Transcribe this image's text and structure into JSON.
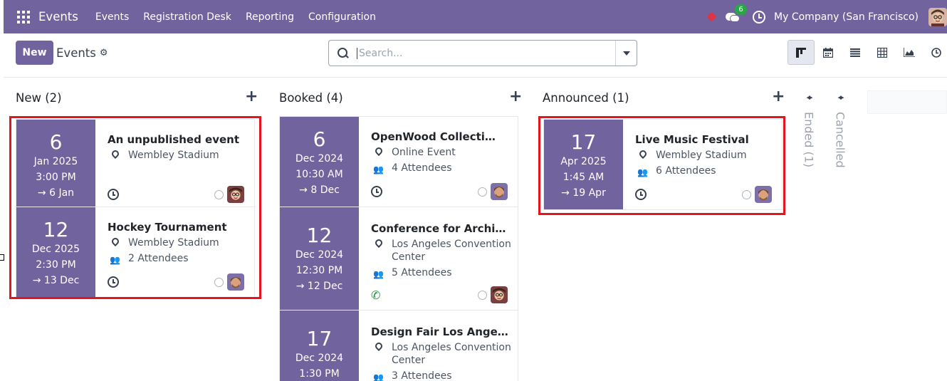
{
  "topnav": {
    "app_name": "Events",
    "menu": [
      "Events",
      "Registration Desk",
      "Reporting",
      "Configuration"
    ],
    "chat_badge": "6",
    "company": "My Company (San Francisco)"
  },
  "control": {
    "new_label": "New",
    "breadcrumb": "Events",
    "search_placeholder": "Search..."
  },
  "views": [
    "kanban-icon",
    "calendar-icon",
    "list-icon",
    "pivot-icon",
    "graph-icon",
    "activity-icon"
  ],
  "columns": [
    {
      "title": "New (2)"
    },
    {
      "title": "Booked (4)"
    },
    {
      "title": "Announced (1)"
    }
  ],
  "folded": [
    {
      "label": "Ended (1)"
    },
    {
      "label": "Cancelled"
    }
  ],
  "cards": {
    "new_0": {
      "day": "6",
      "month_year": "Jan 2025",
      "time": "3:00 PM",
      "end": "6 Jan",
      "title": "An unpublished event",
      "location": "Wembley Stadium"
    },
    "new_1": {
      "day": "12",
      "month_year": "Dec 2025",
      "time": "2:30 PM",
      "end": "13 Dec",
      "title": "Hockey Tournament",
      "location": "Wembley Stadium",
      "attendees": "2 Attendees"
    },
    "booked_0": {
      "day": "6",
      "month_year": "Dec 2024",
      "time": "10:30 AM",
      "end": "8 Dec",
      "title": "OpenWood Collection Online Reveal",
      "location": "Online Event",
      "attendees": "4 Attendees"
    },
    "booked_1": {
      "day": "12",
      "month_year": "Dec 2024",
      "time": "12:30 PM",
      "end": "12 Dec",
      "title": "Conference for Architects",
      "location_line1": "Los Angeles Convention",
      "location_line2": "Center",
      "attendees": "5 Attendees"
    },
    "booked_2": {
      "day": "17",
      "month_year": "Dec 2024",
      "time": "1:30 PM",
      "title": "Design Fair Los Angeles",
      "location_line1": "Los Angeles Convention",
      "location_line2": "Center",
      "attendees": "3 Attendees"
    },
    "announced_0": {
      "day": "17",
      "month_year": "Apr 2025",
      "time": "1:45 AM",
      "end": "19 Apr",
      "title": "Live Music Festival",
      "location": "Wembley Stadium",
      "attendees": "6 Attendees"
    }
  },
  "colors": {
    "brand": "#71639e",
    "highlight": "#e5141f"
  }
}
